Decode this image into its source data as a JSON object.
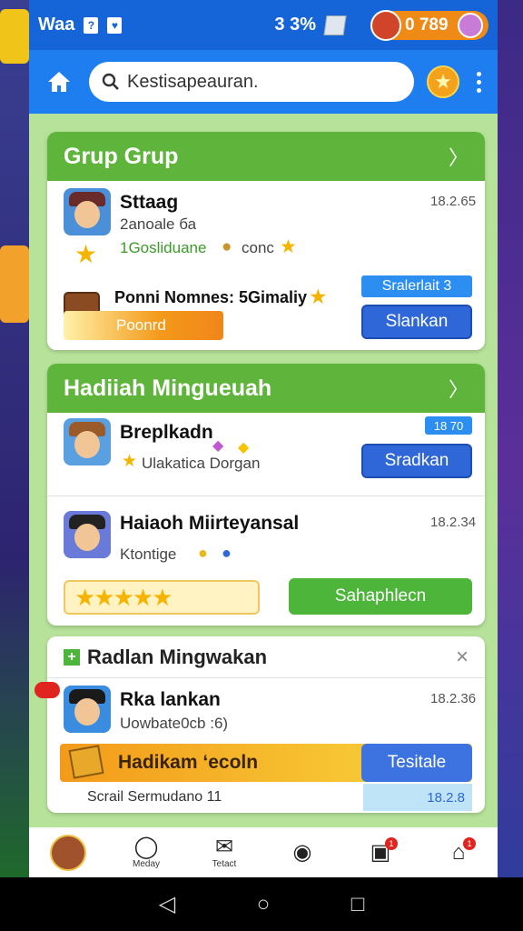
{
  "status_bar": {
    "left_text": "Waa",
    "box1": "?",
    "box2": "♥",
    "signal": "3 3%",
    "coins": "0 789"
  },
  "toolbar": {
    "search_placeholder": "Kestisapeauran."
  },
  "section1": {
    "title": "Grup Grup",
    "item": {
      "name": "Sttaag",
      "subtitle": "2anoale ба",
      "detail": "1Gosliduane",
      "coin_text": "conc",
      "time": "18.2.65"
    },
    "reward": {
      "text": "Ponni Nomnes: 5Gimaliy",
      "bar_label": "Poonrd",
      "tag": "Sralerlait 3",
      "button": "Slankan"
    }
  },
  "section2": {
    "title": "Hadiiah Mingueuah",
    "item1": {
      "name": "Breplkadn",
      "subtitle": "Ulakatica Dorgan",
      "tag": "18 70",
      "button": "Sradkan"
    },
    "item2": {
      "name": "Haiaoh Miirteyansal",
      "subtitle": "Ktontige",
      "time": "18.2.34",
      "button": "Sahaphlecn"
    }
  },
  "section3": {
    "title": "Radlan Mingwakan",
    "close": "×",
    "item": {
      "name": "Rka lankan",
      "subtitle": "Uowbate0cb :6)",
      "time": "18.2.36"
    },
    "banner": {
      "text": "Hadikam ‘ecoln",
      "button": "Tesitale"
    },
    "footer": {
      "text": "Scrail Sermudano 11",
      "value": "18.2.8"
    }
  },
  "bottom_nav": {
    "items": [
      {
        "label": ""
      },
      {
        "label": "Meday"
      },
      {
        "label": "Tetact"
      },
      {
        "label": ""
      },
      {
        "label": ""
      },
      {
        "label": ""
      }
    ],
    "badge1": "1",
    "badge2": "1"
  },
  "colors": {
    "header_blue": "#1e7ef0",
    "section_green": "#5fb53b",
    "button_blue": "#2f67d8",
    "button_green": "#4cb53a",
    "orange_bar": "#f39a1a"
  },
  "icons": [
    "home-icon",
    "search-icon",
    "star-icon",
    "kebab-icon",
    "chevron-right-icon",
    "close-icon",
    "back-icon",
    "home-circle-icon",
    "recents-icon"
  ]
}
